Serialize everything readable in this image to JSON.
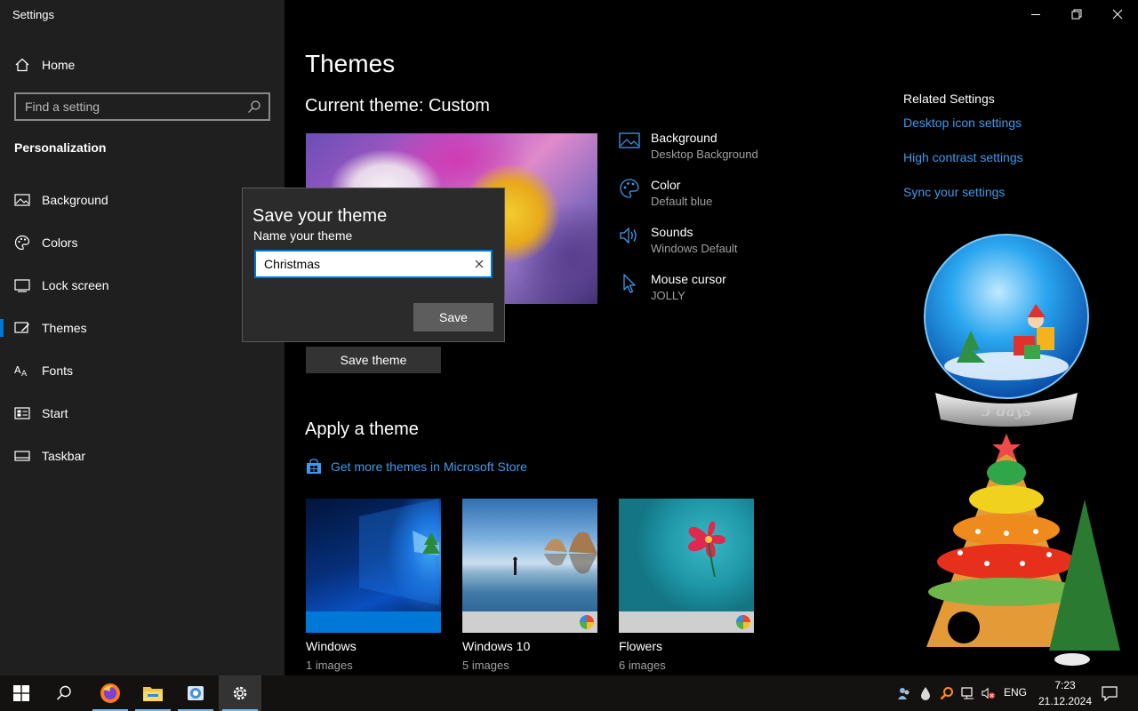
{
  "window": {
    "title": "Settings",
    "controls": [
      "minimize-icon",
      "restore-icon",
      "close-icon"
    ]
  },
  "sidebar": {
    "home_label": "Home",
    "search_placeholder": "Find a setting",
    "section_heading": "Personalization",
    "items": [
      {
        "label": "Background",
        "icon": "background-icon"
      },
      {
        "label": "Colors",
        "icon": "palette-icon"
      },
      {
        "label": "Lock screen",
        "icon": "lock-screen-icon"
      },
      {
        "label": "Themes",
        "icon": "themes-icon",
        "selected": true
      },
      {
        "label": "Fonts",
        "icon": "fonts-icon"
      },
      {
        "label": "Start",
        "icon": "start-icon"
      },
      {
        "label": "Taskbar",
        "icon": "taskbar-icon"
      }
    ]
  },
  "main": {
    "title": "Themes",
    "current_theme": "Current theme: Custom",
    "properties": [
      {
        "title": "Background",
        "value": "Desktop Background",
        "icon": "background-icon"
      },
      {
        "title": "Color",
        "value": "Default blue",
        "icon": "palette-icon"
      },
      {
        "title": "Sounds",
        "value": "Windows Default",
        "icon": "speaker-icon"
      },
      {
        "title": "Mouse cursor",
        "value": "JOLLY",
        "icon": "cursor-icon"
      }
    ],
    "save_theme_label": "Save theme",
    "apply_heading": "Apply a theme",
    "store_link": "Get more themes in Microsoft Store",
    "themes": [
      {
        "name": "Windows",
        "count": "1 images"
      },
      {
        "name": "Windows 10",
        "count": "5 images"
      },
      {
        "name": "Flowers",
        "count": "6 images"
      }
    ]
  },
  "related": {
    "heading": "Related Settings",
    "links": [
      "Desktop icon settings",
      "High contrast settings",
      "Sync your settings"
    ]
  },
  "dialog": {
    "title": "Save your theme",
    "label": "Name your theme",
    "input_value": "Christmas",
    "save_label": "Save"
  },
  "decoration": {
    "countdown": "3 days"
  },
  "taskbar": {
    "apps": [
      "start-icon",
      "search-icon",
      "firefox-icon",
      "file-explorer-icon",
      "app-icon",
      "settings-icon"
    ],
    "language": "ENG",
    "time": "7:23",
    "date": "21.12.2024"
  },
  "colors": {
    "accent": "#0078d7",
    "link": "#3d9aea",
    "sidebar_bg": "#1f1f1f",
    "dialog_bg": "#2b2b2b"
  }
}
